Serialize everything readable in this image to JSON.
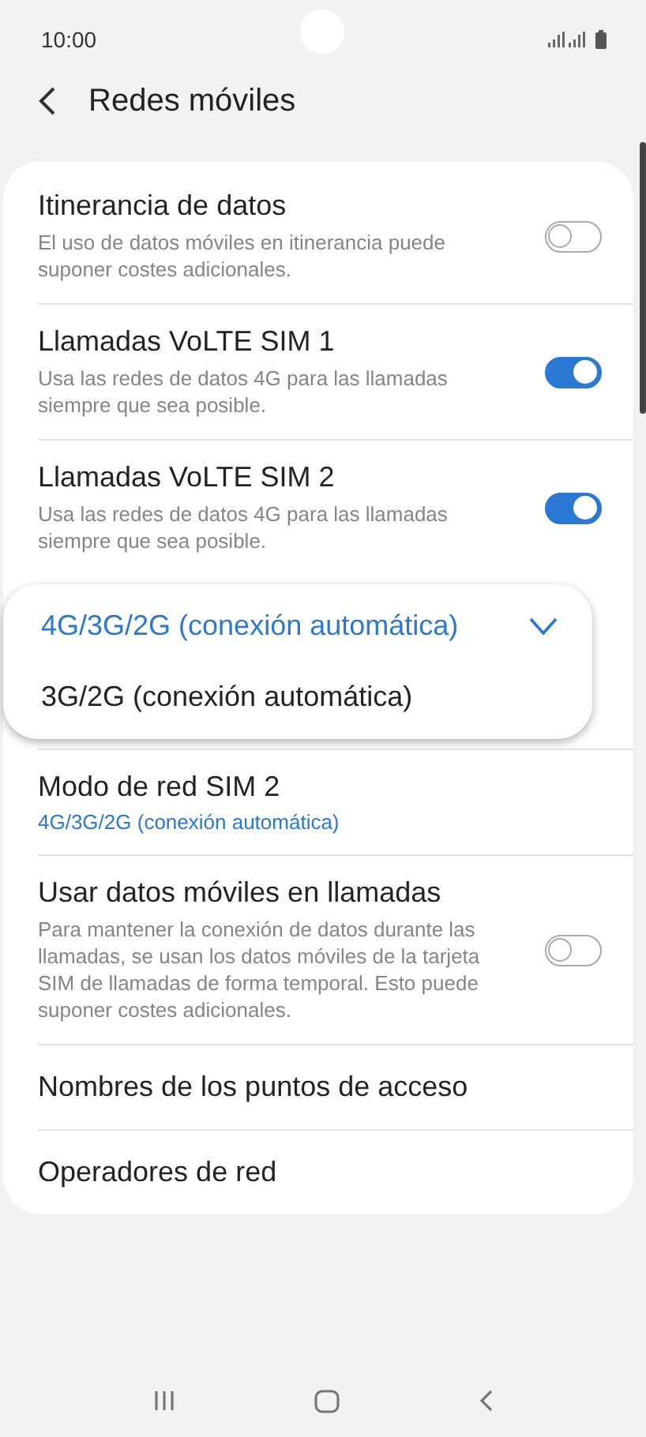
{
  "status_bar": {
    "time": "10:00"
  },
  "header": {
    "title": "Redes móviles"
  },
  "settings": [
    {
      "kind": "toggle",
      "title": "Itinerancia de datos",
      "summary": "El uso de datos móviles en itinerancia puede suponer costes adicionales.",
      "on": false
    },
    {
      "kind": "toggle",
      "title": "Llamadas VoLTE SIM 1",
      "summary": "Usa las redes de datos 4G para las llamadas siempre que sea posible.",
      "on": true
    },
    {
      "kind": "toggle",
      "title": "Llamadas VoLTE SIM 2",
      "summary": "Usa las redes de datos 4G para las llamadas siempre que sea posible.",
      "on": true
    },
    {
      "kind": "popup",
      "options": [
        {
          "label": "4G/3G/2G (conexión automática)",
          "selected": true
        },
        {
          "label": "3G/2G (conexión automática)",
          "selected": false
        }
      ]
    },
    {
      "kind": "value",
      "title": "Modo de red SIM 2",
      "value": "4G/3G/2G (conexión automática)"
    },
    {
      "kind": "toggle",
      "title": "Usar datos móviles en llamadas",
      "summary": "Para mantener la conexión de datos durante las llamadas, se usan los datos móviles de la tarjeta SIM de llamadas de forma temporal. Esto puede suponer costes adicionales.",
      "on": false
    },
    {
      "kind": "link",
      "title": "Nombres de los puntos de acceso"
    },
    {
      "kind": "link",
      "title": "Operadores de red"
    }
  ]
}
